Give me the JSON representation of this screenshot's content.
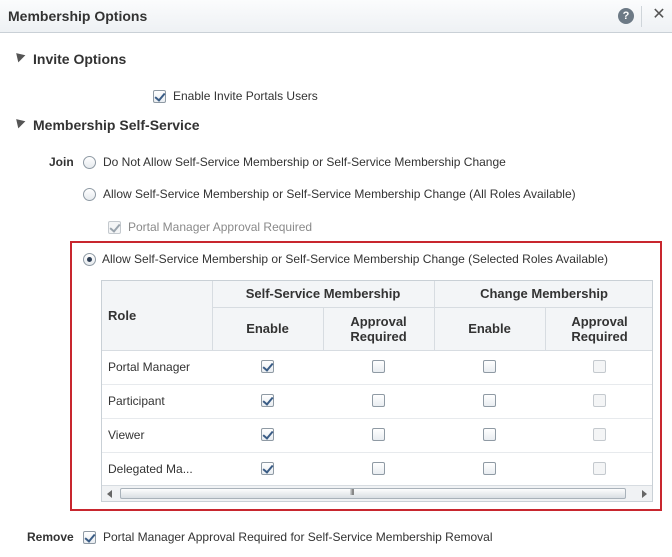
{
  "dialog": {
    "title": "Membership Options",
    "help_icon": "help-icon",
    "close_icon": "close-icon"
  },
  "invite": {
    "header": "Invite Options",
    "enable_invite_label": "Enable Invite Portals Users",
    "enable_invite_checked": true
  },
  "selfservice": {
    "header": "Membership Self-Service",
    "join_label": "Join",
    "options": [
      {
        "label": "Do Not Allow Self-Service Membership or Self-Service Membership Change",
        "selected": false
      },
      {
        "label": "Allow Self-Service Membership or Self-Service Membership Change (All Roles Available)",
        "selected": false
      },
      {
        "label": "Allow Self-Service Membership or Self-Service Membership Change (Selected Roles Available)",
        "selected": true
      }
    ],
    "portal_manager_approval_label": "Portal Manager Approval Required",
    "portal_manager_approval_checked": true,
    "remove_label": "Remove",
    "remove_option_label": "Portal Manager Approval Required for Self-Service Membership Removal",
    "remove_option_checked": true
  },
  "roles_table": {
    "role_header": "Role",
    "group_headers": [
      "Self-Service Membership",
      "Change Membership"
    ],
    "sub_headers": [
      "Enable",
      "Approval\nRequired",
      "Enable",
      "Approval\nRequired"
    ],
    "sub_header_lines": [
      [
        "Enable"
      ],
      [
        "Approval",
        "Required"
      ],
      [
        "Enable"
      ],
      [
        "Approval",
        "Required"
      ]
    ],
    "rows": [
      {
        "role": "Portal Manager",
        "ss_enable": true,
        "ss_approval": false,
        "cm_enable": false,
        "cm_approval": false
      },
      {
        "role": "Participant",
        "ss_enable": true,
        "ss_approval": false,
        "cm_enable": false,
        "cm_approval": false
      },
      {
        "role": "Viewer",
        "ss_enable": true,
        "ss_approval": false,
        "cm_enable": false,
        "cm_approval": false
      },
      {
        "role": "Delegated Ma...",
        "ss_enable": true,
        "ss_approval": false,
        "cm_enable": false,
        "cm_approval": false
      }
    ],
    "scrollbar_grip": "III"
  },
  "colors": {
    "highlight_border": "#c8262e",
    "accent": "#3b5d86"
  }
}
